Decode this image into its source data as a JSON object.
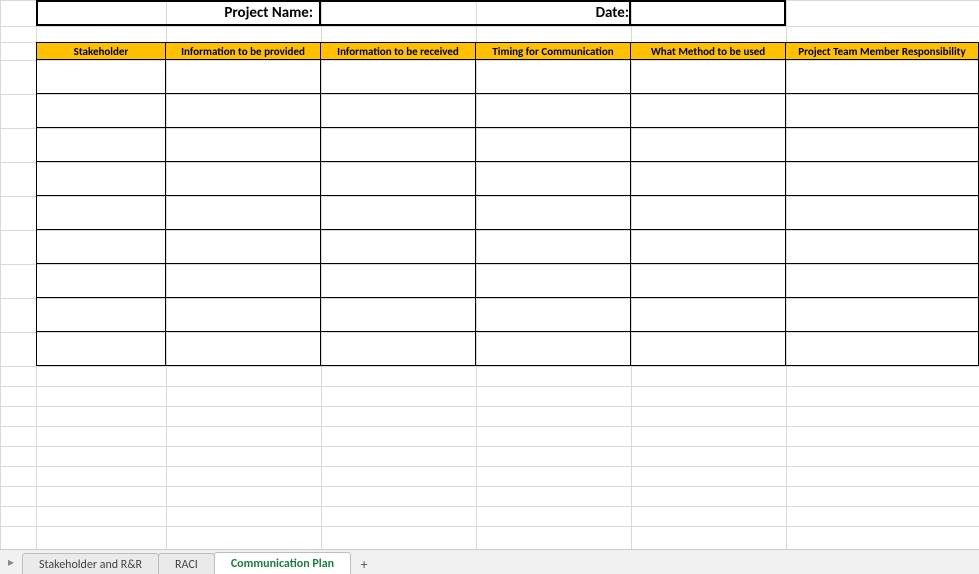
{
  "title_row": {
    "project_label": "Project Name:",
    "project_value": "",
    "date_label": "Date:",
    "date_value": ""
  },
  "columns": [
    "Stakeholder",
    "Information to be provided",
    "Information to be received",
    "Timing for Communication",
    "What Method to be used",
    "Project Team Member Responsibility"
  ],
  "rows": [
    [
      "",
      "",
      "",
      "",
      "",
      ""
    ],
    [
      "",
      "",
      "",
      "",
      "",
      ""
    ],
    [
      "",
      "",
      "",
      "",
      "",
      ""
    ],
    [
      "",
      "",
      "",
      "",
      "",
      ""
    ],
    [
      "",
      "",
      "",
      "",
      "",
      ""
    ],
    [
      "",
      "",
      "",
      "",
      "",
      ""
    ],
    [
      "",
      "",
      "",
      "",
      "",
      ""
    ],
    [
      "",
      "",
      "",
      "",
      "",
      ""
    ],
    [
      "",
      "",
      "",
      "",
      "",
      ""
    ]
  ],
  "sheet_tabs": {
    "nav_icon": "▸",
    "items": [
      {
        "label": "Stakeholder and R&R",
        "active": false
      },
      {
        "label": "RACI",
        "active": false
      },
      {
        "label": "Communication Plan",
        "active": true
      }
    ],
    "add_icon": "+"
  },
  "grid": {
    "row_pos": [
      0,
      26,
      42,
      60,
      94,
      128,
      162,
      196,
      230,
      264,
      298,
      332,
      366,
      386,
      406,
      426,
      446,
      466,
      486,
      506,
      526
    ],
    "col_pos": [
      0,
      36,
      166,
      321,
      476,
      631,
      786,
      979
    ]
  }
}
